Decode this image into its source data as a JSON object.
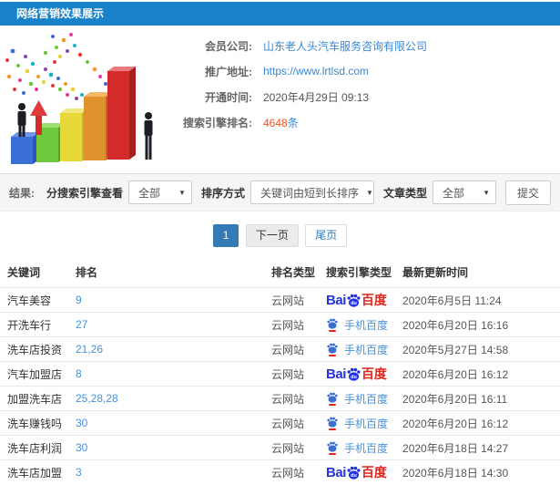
{
  "header": {
    "title": "网络营销效果展示"
  },
  "info": {
    "rows": [
      {
        "label": "会员公司:",
        "value": "山东老人头汽车服务咨询有限公司"
      },
      {
        "label": "推广地址:",
        "value": "https://www.lrtlsd.com"
      },
      {
        "label": "开通时间:",
        "value": "2020年4月29日 09:13"
      },
      {
        "label": "搜索引擎排名:",
        "count": "4648",
        "unit": "条"
      }
    ]
  },
  "filters": {
    "result_label": "结果:",
    "engine_filter_label": "分搜索引擎查看",
    "engine_filter_value": "全部",
    "sort_label": "排序方式",
    "sort_value": "关键词由短到长排序",
    "article_type_label": "文章类型",
    "article_type_value": "全部",
    "submit_label": "提交"
  },
  "pagination": {
    "current": "1",
    "next_label": "下一页",
    "last_label": "尾页"
  },
  "table": {
    "headers": [
      "关键词",
      "排名",
      "排名类型",
      "搜索引擎类型",
      "最新更新时间"
    ],
    "rows": [
      {
        "keyword": "汽车美容",
        "rank": "9",
        "rank_type": "云网站",
        "engine": "baidu",
        "updated": "2020年6月5日 11:24"
      },
      {
        "keyword": "开洗车行",
        "rank": "27",
        "rank_type": "云网站",
        "engine": "mobile",
        "updated": "2020年6月20日 16:16"
      },
      {
        "keyword": "洗车店投资",
        "rank": "21,26",
        "rank_type": "云网站",
        "engine": "mobile",
        "updated": "2020年5月27日 14:58"
      },
      {
        "keyword": "汽车加盟店",
        "rank": "8",
        "rank_type": "云网站",
        "engine": "baidu",
        "updated": "2020年6月20日 16:12"
      },
      {
        "keyword": "加盟洗车店",
        "rank": "25,28,28",
        "rank_type": "云网站",
        "engine": "mobile",
        "updated": "2020年6月20日 16:11"
      },
      {
        "keyword": "洗车赚钱吗",
        "rank": "30",
        "rank_type": "云网站",
        "engine": "mobile",
        "updated": "2020年6月20日 16:12"
      },
      {
        "keyword": "洗车店利润",
        "rank": "30",
        "rank_type": "云网站",
        "engine": "mobile",
        "updated": "2020年6月18日 14:27"
      },
      {
        "keyword": "洗车店加盟",
        "rank": "3",
        "rank_type": "云网站",
        "engine": "baidu",
        "updated": "2020年6月18日 14:30"
      }
    ]
  },
  "icons": {
    "baidu_logo": {
      "bai": "Bai",
      "du": "du",
      "cn": "百度"
    },
    "mobile_baidu_label": "手机百度"
  },
  "colors": {
    "topbar_blue": "#1781c9",
    "link_blue": "#3a87d8",
    "rank_blue": "#4a90d9",
    "count_orange": "#f4521c",
    "pagination_active": "#337ab7",
    "baidu_blue": "#2534dc",
    "baidu_red": "#e1251b"
  }
}
